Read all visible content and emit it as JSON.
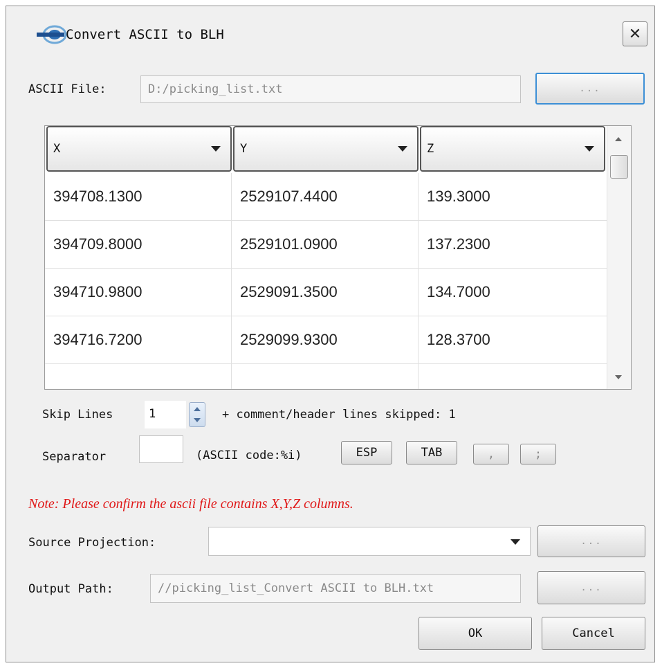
{
  "window": {
    "title": "Convert ASCII to BLH",
    "close_glyph": "✕"
  },
  "ascii_file": {
    "label": "ASCII File:",
    "value": "D:/picking_list.txt",
    "browse_label": "..."
  },
  "table": {
    "columns": [
      "X",
      "Y",
      "Z"
    ],
    "rows": [
      [
        "394708.1300",
        "2529107.4400",
        "139.3000"
      ],
      [
        "394709.8000",
        "2529101.0900",
        "137.2300"
      ],
      [
        "394710.9800",
        "2529091.3500",
        "134.7000"
      ],
      [
        "394716.7200",
        "2529099.9300",
        "128.3700"
      ],
      [
        "",
        "",
        ""
      ]
    ]
  },
  "skip_lines": {
    "label": "Skip Lines",
    "value": "1",
    "info": "+ comment/header lines skipped: 1"
  },
  "separator": {
    "label": "Separator",
    "value": "",
    "ascii_code_text": "(ASCII code:%i)",
    "buttons": [
      "ESP",
      "TAB",
      ",",
      ";"
    ]
  },
  "note": "Note: Please confirm the ascii file contains X,Y,Z columns.",
  "source_projection": {
    "label": "Source Projection:",
    "value": "",
    "browse_label": "..."
  },
  "output_path": {
    "label": "Output Path:",
    "value": "//picking_list_Convert ASCII to BLH.txt",
    "browse_label": "..."
  },
  "actions": {
    "ok": "OK",
    "cancel": "Cancel"
  },
  "icons": [
    "app-logo-icon",
    "close-icon",
    "dropdown-caret-icon",
    "spin-up-icon",
    "spin-down-icon",
    "scroll-up-icon",
    "scroll-down-icon"
  ],
  "colors": {
    "dialog_bg": "#f0f0f0",
    "note_red": "#e01818",
    "focus_blue": "#3c8fd6"
  }
}
